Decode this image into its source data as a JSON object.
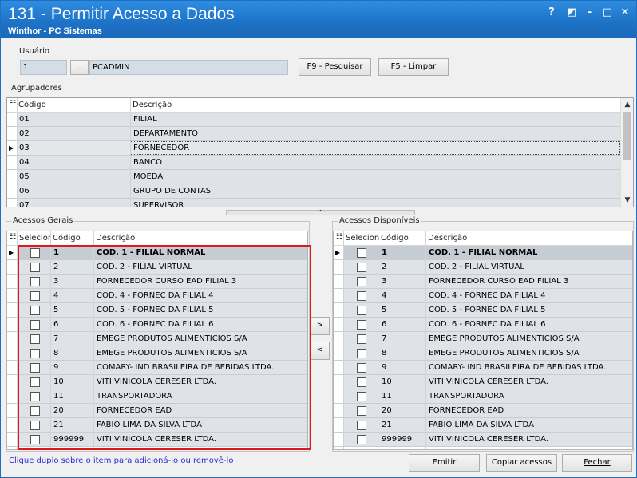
{
  "window": {
    "title": "131 - Permitir Acesso a Dados",
    "subtitle": "Winthor - PC Sistemas",
    "controls": {
      "help": "?",
      "restore": "◩",
      "minimize": "–",
      "maximize": "□",
      "close": "✕"
    }
  },
  "usuario": {
    "label": "Usuário",
    "code": "1",
    "ellipsis": "...",
    "name": "PCADMIN",
    "search_button": "F9 - Pesquisar",
    "clear_button": "F5 - Limpar"
  },
  "agrupadores": {
    "label": "Agrupadores",
    "headers": {
      "codigo": "Código",
      "descricao": "Descrição"
    },
    "rows": [
      {
        "codigo": "01",
        "descricao": "FILIAL"
      },
      {
        "codigo": "02",
        "descricao": "DEPARTAMENTO"
      },
      {
        "codigo": "03",
        "descricao": "FORNECEDOR"
      },
      {
        "codigo": "04",
        "descricao": "BANCO"
      },
      {
        "codigo": "05",
        "descricao": "MOEDA"
      },
      {
        "codigo": "06",
        "descricao": "GRUPO DE CONTAS"
      },
      {
        "codigo": "07",
        "descricao": "SUPERVISOR"
      }
    ],
    "selected_index": 2
  },
  "acessos_gerais": {
    "label": "Acessos Gerais",
    "headers": {
      "selecionar": "Selecior",
      "codigo": "Código",
      "descricao": "Descrição"
    },
    "rows": [
      {
        "codigo": "1",
        "descricao": "COD. 1 - FILIAL NORMAL"
      },
      {
        "codigo": "2",
        "descricao": "COD. 2 - FILIAL VIRTUAL"
      },
      {
        "codigo": "3",
        "descricao": "FORNECEDOR CURSO EAD FILIAL 3"
      },
      {
        "codigo": "4",
        "descricao": "COD. 4 - FORNEC DA FILIAL 4"
      },
      {
        "codigo": "5",
        "descricao": "COD. 5 - FORNEC DA FILIAL 5"
      },
      {
        "codigo": "6",
        "descricao": "COD. 6 - FORNEC DA FILIAL 6"
      },
      {
        "codigo": "7",
        "descricao": "EMEGE PRODUTOS ALIMENTICIOS S/A"
      },
      {
        "codigo": "8",
        "descricao": "EMEGE PRODUTOS ALIMENTICIOS S/A"
      },
      {
        "codigo": "9",
        "descricao": "COMARY- IND BRASILEIRA DE BEBIDAS LTDA."
      },
      {
        "codigo": "10",
        "descricao": "VITI VINICOLA CERESER LTDA."
      },
      {
        "codigo": "11",
        "descricao": "TRANSPORTADORA"
      },
      {
        "codigo": "20",
        "descricao": "FORNECEDOR EAD"
      },
      {
        "codigo": "21",
        "descricao": "FABIO LIMA DA SILVA LTDA"
      },
      {
        "codigo": "999999",
        "descricao": "VITI VINICOLA CERESER LTDA."
      }
    ]
  },
  "acessos_disponiveis": {
    "label": "Acessos Disponíveis",
    "headers": {
      "selecionar": "Selecion",
      "codigo": "Código",
      "descricao": "Descrição"
    },
    "rows": [
      {
        "codigo": "1",
        "descricao": "COD. 1 - FILIAL NORMAL"
      },
      {
        "codigo": "2",
        "descricao": "COD. 2 - FILIAL VIRTUAL"
      },
      {
        "codigo": "3",
        "descricao": "FORNECEDOR CURSO EAD FILIAL 3"
      },
      {
        "codigo": "4",
        "descricao": "COD. 4 - FORNEC DA FILIAL 4"
      },
      {
        "codigo": "5",
        "descricao": "COD. 5 - FORNEC DA FILIAL 5"
      },
      {
        "codigo": "6",
        "descricao": "COD. 6 - FORNEC DA FILIAL 6"
      },
      {
        "codigo": "7",
        "descricao": "EMEGE PRODUTOS ALIMENTICIOS S/A"
      },
      {
        "codigo": "8",
        "descricao": "EMEGE PRODUTOS ALIMENTICIOS S/A"
      },
      {
        "codigo": "9",
        "descricao": "COMARY- IND BRASILEIRA DE BEBIDAS LTDA."
      },
      {
        "codigo": "10",
        "descricao": "VITI VINICOLA CERESER LTDA."
      },
      {
        "codigo": "11",
        "descricao": "TRANSPORTADORA"
      },
      {
        "codigo": "20",
        "descricao": "FORNECEDOR EAD"
      },
      {
        "codigo": "21",
        "descricao": "FABIO LIMA DA SILVA LTDA"
      },
      {
        "codigo": "999999",
        "descricao": "VITI VINICOLA CERESER LTDA."
      }
    ]
  },
  "transfer": {
    "add": ">",
    "remove": "<"
  },
  "footer": {
    "hint": "Clique duplo sobre o item para adicioná-lo ou removê-lo",
    "emitir": "Emitir",
    "copiar": "Copiar acessos",
    "fechar": "Fechar"
  },
  "colors": {
    "title_bar": "#1e74c9",
    "highlight_box": "#e0171b",
    "hint_text": "#2b2bd8"
  },
  "icons": [
    "help-icon",
    "restore-icon",
    "minimize-icon",
    "maximize-icon",
    "close-icon",
    "row-indicator-icon",
    "column-chooser-icon"
  ]
}
